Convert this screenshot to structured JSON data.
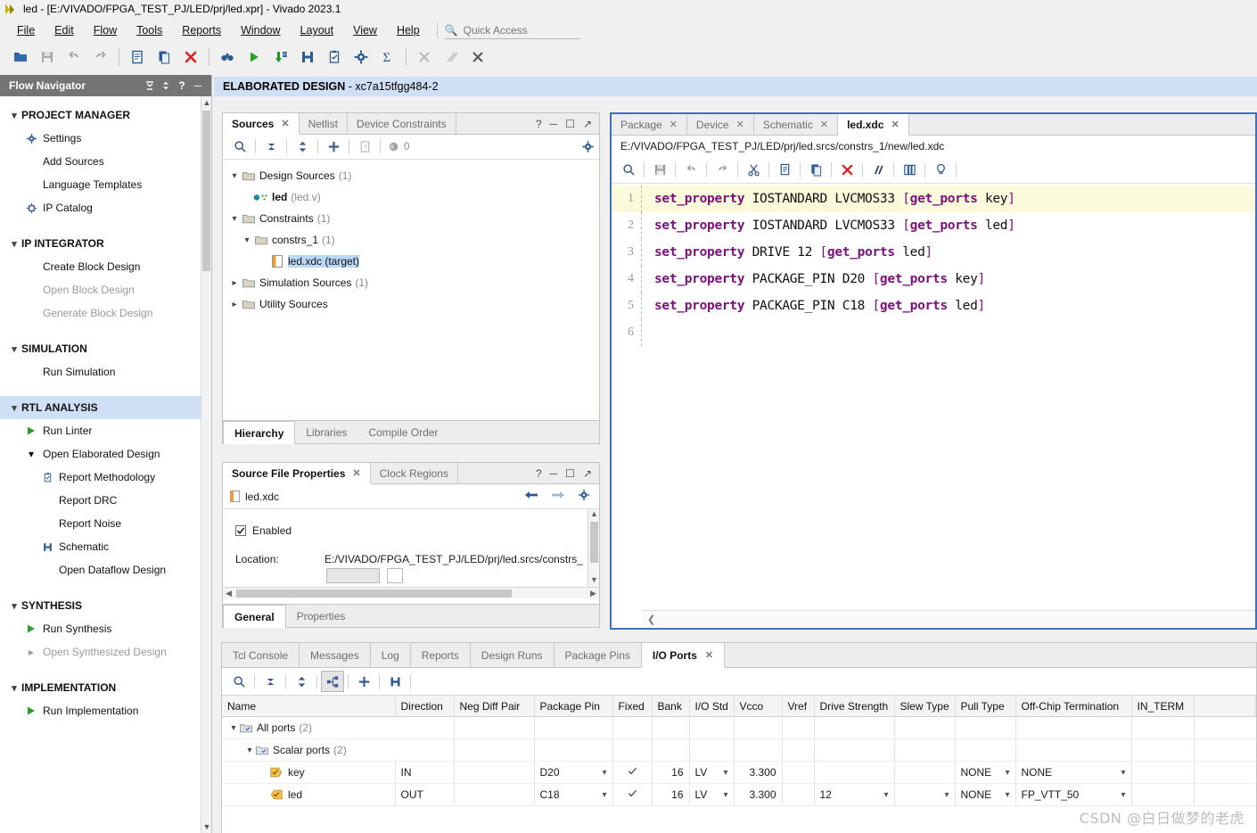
{
  "window": {
    "title": "led - [E:/VIVADO/FPGA_TEST_PJ/LED/prj/led.xpr] - Vivado 2023.1"
  },
  "menubar": {
    "items": [
      "File",
      "Edit",
      "Flow",
      "Tools",
      "Reports",
      "Window",
      "Layout",
      "View",
      "Help"
    ]
  },
  "quick_access": {
    "placeholder": "Quick Access",
    "value": ""
  },
  "toolbar": {
    "buttons": [
      "open-project-icon",
      "save-icon",
      "undo-icon",
      "redo-icon",
      "new-file-icon",
      "copy-icon",
      "close-red-icon",
      "search-binoculars-icon",
      "run-green-icon",
      "download-bitstream-icon",
      "schematic-icon",
      "report-methodology-icon",
      "settings-gear-icon",
      "sigma-icon",
      "cross-hatch-icon",
      "slash-icon",
      "x-scissor-icon"
    ]
  },
  "banner": {
    "label": "ELABORATED DESIGN",
    "device": "- xc7a15tfgg484-2"
  },
  "flow_navigator": {
    "title": "Flow Navigator",
    "sections": [
      {
        "group": "PROJECT MANAGER",
        "selected": false,
        "items": [
          {
            "label": "Settings",
            "icon": "gear-icon",
            "disabled": false
          },
          {
            "label": "Add Sources",
            "icon": "",
            "disabled": false
          },
          {
            "label": "Language Templates",
            "icon": "",
            "disabled": false
          },
          {
            "label": "IP Catalog",
            "icon": "ip-catalog-icon",
            "disabled": false
          }
        ]
      },
      {
        "group": "IP INTEGRATOR",
        "selected": false,
        "items": [
          {
            "label": "Create Block Design",
            "icon": "",
            "disabled": false
          },
          {
            "label": "Open Block Design",
            "icon": "",
            "disabled": true
          },
          {
            "label": "Generate Block Design",
            "icon": "",
            "disabled": true
          }
        ]
      },
      {
        "group": "SIMULATION",
        "selected": false,
        "items": [
          {
            "label": "Run Simulation",
            "icon": "",
            "disabled": false
          }
        ]
      },
      {
        "group": "RTL ANALYSIS",
        "selected": true,
        "items": [
          {
            "label": "Run Linter",
            "icon": "run-green-icon",
            "disabled": false
          },
          {
            "label": "Open Elaborated Design",
            "icon": "chevron-down-icon",
            "disabled": false
          },
          {
            "label": "Report Methodology",
            "icon": "clipboard-check-icon",
            "disabled": false,
            "level": 2
          },
          {
            "label": "Report DRC",
            "icon": "",
            "disabled": false,
            "level": 2
          },
          {
            "label": "Report Noise",
            "icon": "",
            "disabled": false,
            "level": 2
          },
          {
            "label": "Schematic",
            "icon": "schematic-icon",
            "disabled": false,
            "level": 2
          },
          {
            "label": "Open Dataflow Design",
            "icon": "",
            "disabled": false,
            "level": 2
          }
        ]
      },
      {
        "group": "SYNTHESIS",
        "selected": false,
        "items": [
          {
            "label": "Run Synthesis",
            "icon": "run-green-icon",
            "disabled": false
          },
          {
            "label": "Open Synthesized Design",
            "icon": "chevron-right-icon",
            "disabled": true
          }
        ]
      },
      {
        "group": "IMPLEMENTATION",
        "selected": false,
        "items": [
          {
            "label": "Run Implementation",
            "icon": "run-green-icon",
            "disabled": false
          }
        ]
      }
    ]
  },
  "sources_panel": {
    "tabs": [
      {
        "label": "Sources",
        "active": true,
        "closable": true
      },
      {
        "label": "Netlist",
        "active": false,
        "closable": false
      },
      {
        "label": "Device Constraints",
        "active": false,
        "closable": false
      }
    ],
    "toolbar_badge": "0",
    "tree": [
      {
        "label": "Design Sources",
        "count": "(1)",
        "chev": "down",
        "icon": "folder-icon",
        "indent": 0
      },
      {
        "label": "led",
        "count": "(led.v)",
        "chev": "",
        "icon": "verilog-module-icon",
        "indent": 1,
        "bold": true
      },
      {
        "label": "Constraints",
        "count": "(1)",
        "chev": "down",
        "icon": "folder-icon",
        "indent": 0
      },
      {
        "label": "constrs_1",
        "count": "(1)",
        "chev": "down",
        "icon": "folder-icon",
        "indent": 1
      },
      {
        "label": "led.xdc (target)",
        "count": "",
        "chev": "",
        "icon": "xdc-file-icon",
        "indent": 2,
        "selected": true
      },
      {
        "label": "Simulation Sources",
        "count": "(1)",
        "chev": "right",
        "icon": "folder-icon",
        "indent": 0
      },
      {
        "label": "Utility Sources",
        "count": "",
        "chev": "right",
        "icon": "folder-icon",
        "indent": 0
      }
    ],
    "bottom_tabs": [
      {
        "label": "Hierarchy",
        "active": true
      },
      {
        "label": "Libraries",
        "active": false
      },
      {
        "label": "Compile Order",
        "active": false
      }
    ]
  },
  "source_file_properties": {
    "tabs": [
      {
        "label": "Source File Properties",
        "active": true,
        "closable": true
      },
      {
        "label": "Clock Regions",
        "active": false,
        "closable": false
      }
    ],
    "file_name": "led.xdc",
    "enabled_label": "Enabled",
    "enabled_checked": true,
    "location_label": "Location:",
    "location_value": "E:/VIVADO/FPGA_TEST_PJ/LED/prj/led.srcs/constrs_",
    "bottom_tabs": [
      {
        "label": "General",
        "active": true
      },
      {
        "label": "Properties",
        "active": false
      }
    ]
  },
  "editor": {
    "tabs": [
      {
        "label": "Package",
        "active": false,
        "closable": true
      },
      {
        "label": "Device",
        "active": false,
        "closable": true
      },
      {
        "label": "Schematic",
        "active": false,
        "closable": true
      },
      {
        "label": "led.xdc",
        "active": true,
        "closable": true
      }
    ],
    "path": "E:/VIVADO/FPGA_TEST_PJ/LED/prj/led.srcs/constrs_1/new/led.xdc",
    "toolbar_buttons": [
      "search-icon",
      "save-icon",
      "undo-icon",
      "redo-icon",
      "cut-scissors-icon",
      "copy-icon",
      "paste-icon",
      "delete-red-x-icon",
      "comment-slashes-icon",
      "indent-icon",
      "bulb-icon"
    ],
    "lines": [
      {
        "n": "1",
        "highlight": true,
        "tokens": [
          {
            "t": "set_property",
            "c": "kw"
          },
          {
            "t": " IOSTANDARD LVCMOS33 ",
            "c": "pl"
          },
          {
            "t": "[",
            "c": "br"
          },
          {
            "t": "get_ports",
            "c": "kw"
          },
          {
            "t": " key",
            "c": "pl"
          },
          {
            "t": "]",
            "c": "br"
          }
        ]
      },
      {
        "n": "2",
        "highlight": false,
        "tokens": [
          {
            "t": "set_property",
            "c": "kw"
          },
          {
            "t": " IOSTANDARD LVCMOS33 ",
            "c": "pl"
          },
          {
            "t": "[",
            "c": "br"
          },
          {
            "t": "get_ports",
            "c": "kw"
          },
          {
            "t": " led",
            "c": "pl"
          },
          {
            "t": "]",
            "c": "br"
          }
        ]
      },
      {
        "n": "3",
        "highlight": false,
        "tokens": [
          {
            "t": "set_property",
            "c": "kw"
          },
          {
            "t": " DRIVE 12 ",
            "c": "pl"
          },
          {
            "t": "[",
            "c": "br"
          },
          {
            "t": "get_ports",
            "c": "kw"
          },
          {
            "t": " led",
            "c": "pl"
          },
          {
            "t": "]",
            "c": "br"
          }
        ]
      },
      {
        "n": "4",
        "highlight": false,
        "tokens": [
          {
            "t": "set_property",
            "c": "kw"
          },
          {
            "t": " PACKAGE_PIN D20 ",
            "c": "pl"
          },
          {
            "t": "[",
            "c": "br"
          },
          {
            "t": "get_ports",
            "c": "kw"
          },
          {
            "t": " key",
            "c": "pl"
          },
          {
            "t": "]",
            "c": "br"
          }
        ]
      },
      {
        "n": "5",
        "highlight": false,
        "tokens": [
          {
            "t": "set_property",
            "c": "kw"
          },
          {
            "t": " PACKAGE_PIN C18 ",
            "c": "pl"
          },
          {
            "t": "[",
            "c": "br"
          },
          {
            "t": "get_ports",
            "c": "kw"
          },
          {
            "t": " led",
            "c": "pl"
          },
          {
            "t": "]",
            "c": "br"
          }
        ]
      },
      {
        "n": "6",
        "highlight": false,
        "tokens": []
      }
    ]
  },
  "results_panel": {
    "tabs": [
      {
        "label": "Tcl Console",
        "active": false,
        "closable": false
      },
      {
        "label": "Messages",
        "active": false,
        "closable": false
      },
      {
        "label": "Log",
        "active": false,
        "closable": false
      },
      {
        "label": "Reports",
        "active": false,
        "closable": false
      },
      {
        "label": "Design Runs",
        "active": false,
        "closable": false
      },
      {
        "label": "Package Pins",
        "active": false,
        "closable": false
      },
      {
        "label": "I/O Ports",
        "active": true,
        "closable": true
      }
    ],
    "toolbar_buttons": [
      "search-icon",
      "collapse-all-icon",
      "expand-all-icon",
      "hierarchy-icon",
      "add-icon",
      "schematic-icon"
    ],
    "columns": [
      "Name",
      "Direction",
      "Neg Diff Pair",
      "Package Pin",
      "Fixed",
      "Bank",
      "I/O Std",
      "Vcco",
      "Vref",
      "Drive Strength",
      "Slew Type",
      "Pull Type",
      "Off-Chip Termination",
      "IN_TERM"
    ],
    "rows": [
      {
        "kind": "group",
        "indent": 0,
        "chev": "down",
        "icon": "ports-folder-icon",
        "name": "All ports",
        "count": "(2)",
        "direction": "",
        "neg_diff_pair": "",
        "package_pin": "",
        "fixed": "",
        "bank": "",
        "io_std": "",
        "vcco": "",
        "vref": "",
        "drive_strength": "",
        "slew_type": "",
        "pull_type": "",
        "off_chip_termination": "",
        "in_term": ""
      },
      {
        "kind": "group",
        "indent": 1,
        "chev": "down",
        "icon": "ports-folder-icon",
        "name": "Scalar ports",
        "count": "(2)",
        "direction": "",
        "neg_diff_pair": "",
        "package_pin": "",
        "fixed": "",
        "bank": "",
        "io_std": "",
        "vcco": "",
        "vref": "",
        "drive_strength": "",
        "slew_type": "",
        "pull_type": "",
        "off_chip_termination": "",
        "in_term": ""
      },
      {
        "kind": "port",
        "indent": 2,
        "chev": "",
        "icon": "input-port-icon",
        "name": "key",
        "count": "",
        "direction": "IN",
        "neg_diff_pair": "",
        "package_pin": "D20",
        "fixed": "checked",
        "bank": "16",
        "io_std": "LV",
        "vcco": "3.300",
        "vref": "",
        "drive_strength": "",
        "slew_type": "",
        "pull_type": "NONE",
        "off_chip_termination": "NONE",
        "in_term": ""
      },
      {
        "kind": "port",
        "indent": 2,
        "chev": "",
        "icon": "output-port-icon",
        "name": "led",
        "count": "",
        "direction": "OUT",
        "neg_diff_pair": "",
        "package_pin": "C18",
        "fixed": "checked",
        "bank": "16",
        "io_std": "LV",
        "vcco": "3.300",
        "vref": "",
        "drive_strength": "12",
        "slew_type": "",
        "pull_type": "NONE",
        "off_chip_termination": "FP_VTT_50",
        "in_term": ""
      }
    ]
  },
  "watermark": {
    "text": "CSDN @白日做梦的老虎"
  },
  "colors": {
    "accent_blue": "#3f72c1",
    "banner_blue": "#cfdff6",
    "selection_blue": "#bcd8f7",
    "nav_header_gray": "#747474",
    "keyword_purple": "#7a0f7a",
    "highlight_yellow": "#fbfbdc",
    "green_run": "#2aa02a",
    "red_x": "#e02020"
  }
}
